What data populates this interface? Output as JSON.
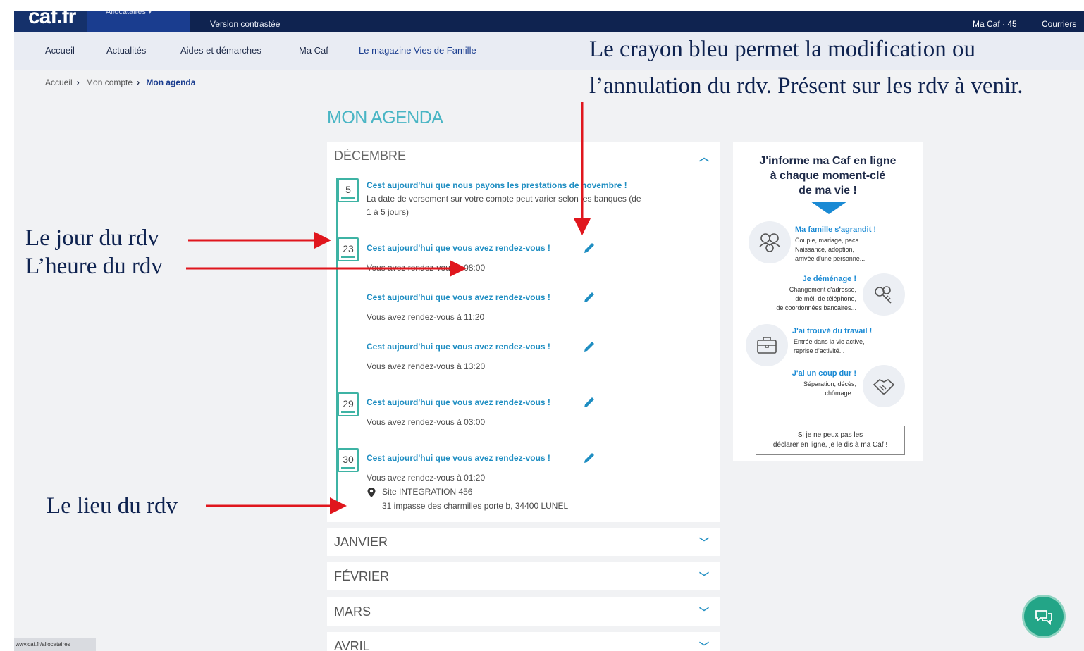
{
  "header": {
    "logo": "caf.fr",
    "audience_tab": "Allocataires",
    "contrast": "Version contrastée",
    "account": "Ma Caf · 45",
    "mail": "Courriers"
  },
  "nav": [
    "Accueil",
    "Actualités",
    "Aides et démarches",
    "Ma Caf",
    "Le magazine Vies de Famille"
  ],
  "breadcrumb": [
    "Accueil",
    "Mon compte",
    "Mon agenda"
  ],
  "page_title": "MON AGENDA",
  "agenda": {
    "open_month": "DÉCEMBRE",
    "events": [
      {
        "day": "5",
        "title": "Cest aujourd'hui que nous payons les prestations de novembre !",
        "line1": "La date de versement sur votre compte peut varier selon les banques (de",
        "line2": "1 à 5 jours)"
      },
      {
        "day": "23",
        "title": "Cest aujourd'hui que vous avez rendez-vous !",
        "line1": "Vous avez rendez-vous à 08:00"
      },
      {
        "day": "",
        "title": "Cest aujourd'hui que vous avez rendez-vous !",
        "line1": "Vous avez rendez-vous à 11:20"
      },
      {
        "day": "",
        "title": "Cest aujourd'hui que vous avez rendez-vous !",
        "line1": "Vous avez rendez-vous à 13:20"
      },
      {
        "day": "29",
        "title": "Cest aujourd'hui que vous avez rendez-vous !",
        "line1": "Vous avez rendez-vous à 03:00"
      },
      {
        "day": "30",
        "title": "Cest aujourd'hui que vous avez rendez-vous !",
        "line1": "Vous avez rendez-vous à 01:20",
        "place": "Site INTEGRATION 456",
        "address": "31 impasse des charmilles porte b, 34400 LUNEL"
      }
    ],
    "other_months": [
      "JANVIER",
      "FÉVRIER",
      "MARS",
      "AVRIL"
    ]
  },
  "info_card": {
    "title_lines": [
      "J'informe ma Caf en ligne",
      "à chaque moment-clé",
      "de ma vie !"
    ],
    "items": [
      {
        "title": "Ma famille s'agrandit !",
        "lines": [
          "Couple, mariage, pacs...",
          "Naissance, adoption,",
          "arrivée d'une personne..."
        ],
        "icon": "family-icon"
      },
      {
        "title": "Je déménage !",
        "lines": [
          "Changement d'adresse,",
          "de mél, de téléphone,",
          "de coordonnées bancaires..."
        ],
        "icon": "keys-icon"
      },
      {
        "title": "J'ai trouvé du travail !",
        "lines": [
          "Entrée dans la vie active,",
          "reprise d'activité..."
        ],
        "icon": "briefcase-icon"
      },
      {
        "title": "J'ai un coup dur !",
        "lines": [
          "Séparation, décès,",
          "chômage..."
        ],
        "icon": "handshake-icon"
      }
    ],
    "button_lines": [
      "Si je ne peux pas les",
      "déclarer en ligne, je le dis à ma Caf !"
    ]
  },
  "status_url": "wwv.caf.fr/allocataires",
  "annotations": {
    "pencil_note_line1": "Le crayon bleu permet la modification ou",
    "pencil_note_line2": "l’annulation du rdv. Présent sur les rdv à venir.",
    "day_note": "Le jour du rdv",
    "time_note": "L’heure du rdv",
    "place_note": "Le lieu du rdv"
  },
  "colors": {
    "dark_navy": "#0f2350",
    "teal": "#3eb3a4",
    "link_blue": "#1f8ec2",
    "arrow_red": "#e0161d",
    "chat_green": "#23a587"
  }
}
